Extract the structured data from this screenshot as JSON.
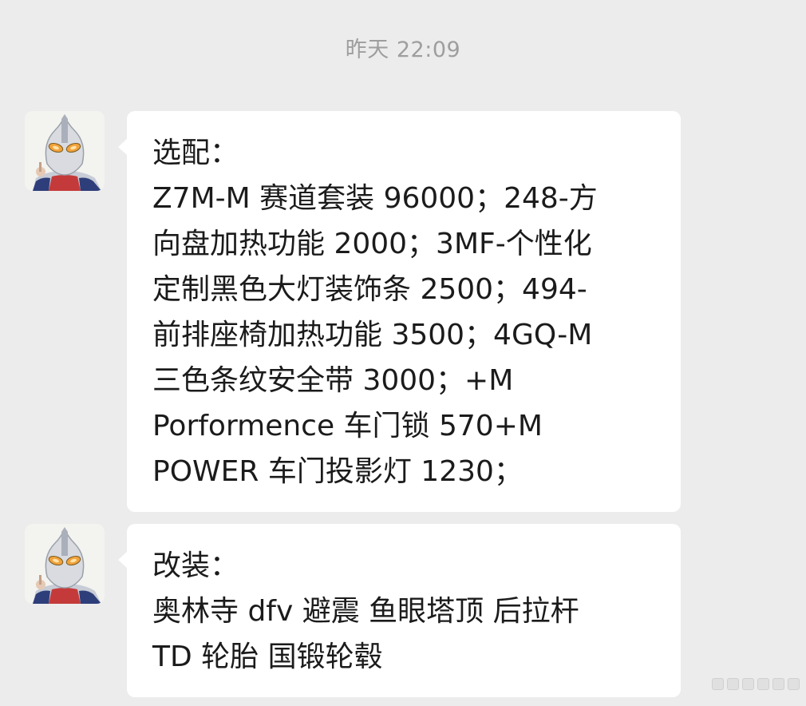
{
  "timestamp": "昨天 22:09",
  "messages": [
    {
      "lines": [
        "选配：",
        "Z7M-M 赛道套装 96000；248-方",
        "向盘加热功能 2000；3MF-个性化",
        "定制黑色大灯装饰条 2500；494-",
        "前排座椅加热功能 3500；4GQ-M",
        "三色条纹安全带 3000；+M",
        "Porformence 车门锁   570+M",
        "POWER 车门投影灯  1230；"
      ]
    },
    {
      "lines": [
        "改装：",
        "奥林寺 dfv 避震 鱼眼塔顶 后拉杆",
        "TD 轮胎 国锻轮毂"
      ]
    }
  ]
}
